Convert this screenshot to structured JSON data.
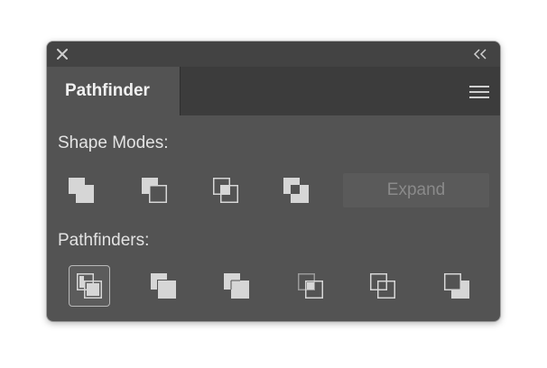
{
  "panel": {
    "tab_label": "Pathfinder",
    "close_icon": "close-icon",
    "collapse_icon": "double-chevron-left-icon",
    "menu_icon": "hamburger-menu-icon"
  },
  "shape_modes": {
    "label": "Shape Modes:",
    "buttons": [
      "unite-icon",
      "minus-front-icon",
      "intersect-icon",
      "exclude-icon"
    ],
    "expand_label": "Expand"
  },
  "pathfinders": {
    "label": "Pathfinders:",
    "buttons": [
      "divide-icon",
      "trim-icon",
      "merge-icon",
      "crop-icon",
      "outline-icon",
      "minus-back-icon"
    ],
    "selected": "divide-icon"
  },
  "colors": {
    "panel_bg": "#535353",
    "titlebar_bg": "#434343",
    "tabbar_bg": "#3c3c3c",
    "icon_fill": "#d6d6d6",
    "text": "#e3e3e3"
  }
}
